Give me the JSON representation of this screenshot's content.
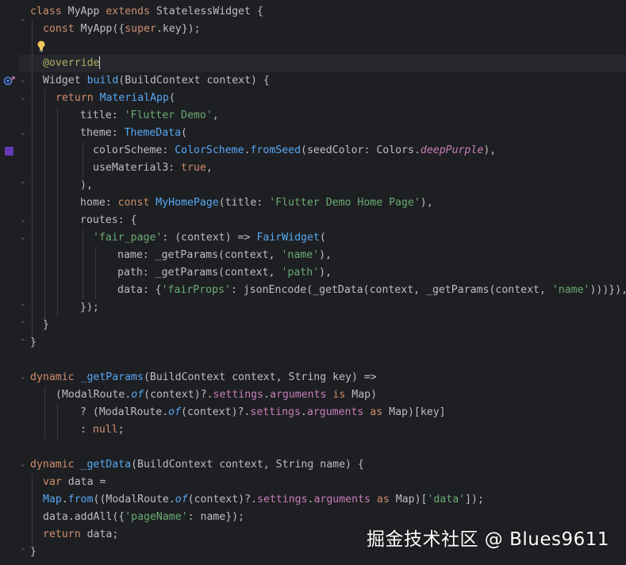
{
  "code": {
    "l1": [
      "class",
      "MyApp",
      "extends",
      "StatelessWidget",
      "{"
    ],
    "l2": [
      "const",
      "MyApp({",
      "super",
      ".key});"
    ],
    "l4": "@override",
    "l5": [
      "Widget",
      "build",
      "(BuildContext context) {"
    ],
    "l6": [
      "return",
      "MaterialApp",
      "("
    ],
    "l7": [
      "title: ",
      "'Flutter Demo'",
      ","
    ],
    "l8": [
      "theme: ",
      "ThemeData",
      "("
    ],
    "l9": [
      "colorScheme: ",
      "ColorScheme",
      ".",
      "fromSeed",
      "(seedColor: Colors.",
      "deepPurple",
      "),"
    ],
    "l10": [
      "useMaterial3: ",
      "true",
      ","
    ],
    "l11": "),",
    "l12": [
      "home: ",
      "const",
      " ",
      "MyHomePage",
      "(title: ",
      "'Flutter Demo Home Page'",
      "),"
    ],
    "l13": "routes: {",
    "l14": [
      "'fair_page'",
      ": (context) => ",
      "FairWidget",
      "("
    ],
    "l15": [
      "name: _getParams(context, ",
      "'name'",
      "),"
    ],
    "l16": [
      "path: _getParams(context, ",
      "'path'",
      "),"
    ],
    "l17": [
      "data: {",
      "'fairProps'",
      ": jsonEncode(_getData(context, _getParams(context, ",
      "'name'",
      ")))}),"
    ],
    "l18": "});",
    "l19": "}",
    "l20": "}",
    "l22": [
      "dynamic",
      "_getParams",
      "(BuildContext context, String key) =>"
    ],
    "l23": [
      "(ModalRoute.",
      "of",
      "(context)?.",
      "settings",
      ".",
      "arguments",
      "is",
      "Map)"
    ],
    "l24": [
      "? (ModalRoute.",
      "of",
      "(context)?.",
      "settings",
      ".",
      "arguments",
      "as",
      "Map)[key]"
    ],
    "l25": [
      ": ",
      "null",
      ";"
    ],
    "l27": [
      "dynamic",
      "_getData",
      "(BuildContext context, String name) {"
    ],
    "l28": [
      "var",
      " data ="
    ],
    "l29": [
      "Map",
      ".",
      "from",
      "((ModalRoute.",
      "of",
      "(context)?.",
      "settings",
      ".",
      "arguments",
      "as",
      "Map)[",
      "'data'",
      "]);"
    ],
    "l30": [
      "data.addAll({",
      "'pageName'",
      ": name});"
    ],
    "l31": [
      "return",
      " data;"
    ],
    "l32": "}"
  },
  "gutter_icons": {
    "bulb": "lightbulb-icon",
    "override": "override-method-icon",
    "color_swatch": "color-swatch-icon",
    "color_swatch_color": "#673ab7"
  },
  "watermark": "掘金技术社区 @ Blues9611"
}
